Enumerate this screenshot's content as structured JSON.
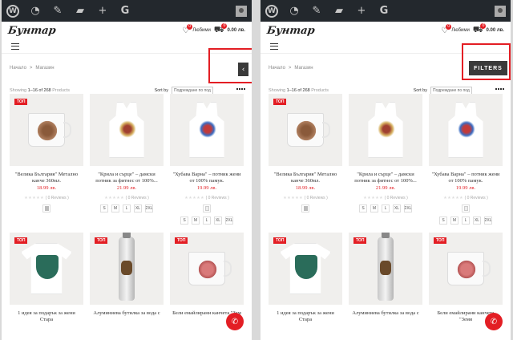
{
  "header": {
    "favorites_label": "Любими",
    "favorites_count": "0",
    "cart_count": "0",
    "cart_total": "0.00 лв."
  },
  "breadcrumb": {
    "home": "Начало",
    "separator": ">",
    "current": "Магазин"
  },
  "toolbar": {
    "showing_word": "Showing",
    "range": "1–16 of 268",
    "products_word": "Products",
    "sort_label": "Sort by",
    "sort_value": "Подреждане по под"
  },
  "filters_label": "FILTERS",
  "toggle_icon": "‹",
  "whatsapp_icon": "✆",
  "top_badge": "ТОП",
  "products": [
    {
      "title": "\"Велика България\" Метално канче 360мл.",
      "price": "18.99 лв.",
      "reviews": "( 0 Reviews )",
      "sizes": [],
      "top": true
    },
    {
      "title": "\"Крила и сърце\" – дамски потник за фитнес от 100%...",
      "price": "21.99 лв.",
      "reviews": "( 0 Reviews )",
      "sizes": [
        "S",
        "M",
        "L",
        "XL",
        "2XL"
      ],
      "top": false
    },
    {
      "title": "\"Хубава Варна\" – потник жени от 100% памук.",
      "price": "19.99 лв.",
      "reviews": "( 0 Reviews )",
      "sizes": [
        "S",
        "M",
        "L",
        "XL",
        "2XL"
      ],
      "top": false
    },
    {
      "title": "1 идея за подарък за жени Стара",
      "price": "",
      "reviews": "",
      "sizes": [],
      "top": true
    },
    {
      "title": "Алуминиева бутилка за вода с",
      "price": "",
      "reviews": "",
      "sizes": [],
      "top": true
    },
    {
      "title": "Бели емайлирани канчета \"Зем",
      "price": "",
      "reviews": "",
      "sizes": [],
      "top": true
    }
  ],
  "products_right_last_title": "Бели емайлирани канчета \"Земя"
}
